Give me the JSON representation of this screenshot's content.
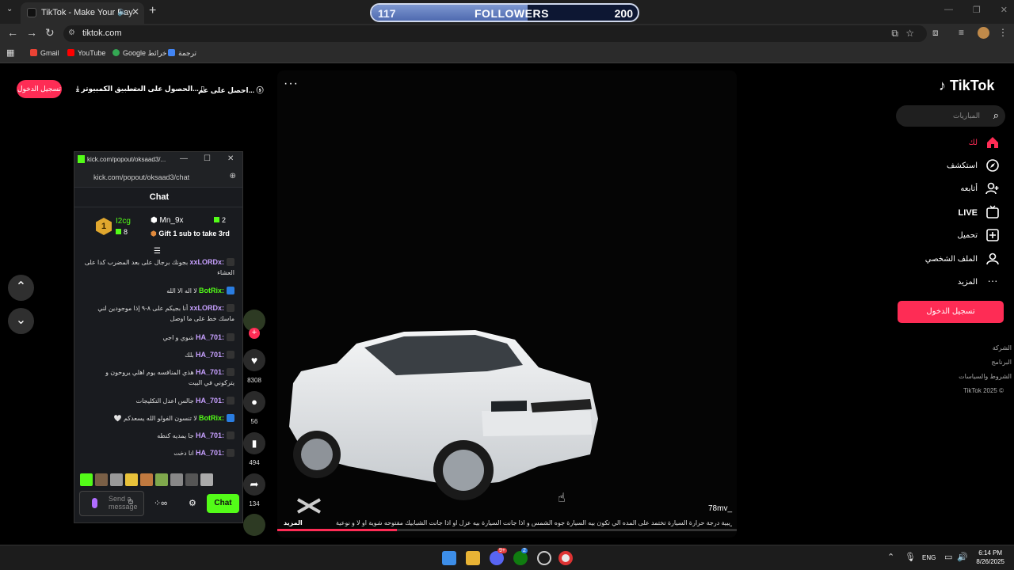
{
  "browser": {
    "tab_title": "TikTok - Make Your Day",
    "url": "tiktok.com",
    "bookmarks": [
      "Gmail",
      "YouTube",
      "Google خرائط",
      "ترجمة"
    ]
  },
  "followers_goal": {
    "current": "117",
    "label": "FOLLOWERS",
    "goal": "200",
    "progress_fraction": 0.585
  },
  "tiktok": {
    "brand": "TikTok",
    "top_login": "تسجيل الدخول",
    "top_links": [
      "تطبيق الكمبيوتر",
      "الحصول على الت...",
      "احصل على عم..."
    ],
    "search_placeholder": "المباريات",
    "sidebar": [
      {
        "label": "لك",
        "icon": "home-icon",
        "active": true
      },
      {
        "label": "استكشف",
        "icon": "compass-icon",
        "active": false
      },
      {
        "label": "أتابعه",
        "icon": "following-icon",
        "active": false
      },
      {
        "label": "LIVE",
        "icon": "live-icon",
        "active": false
      },
      {
        "label": "تحميل",
        "icon": "upload-icon",
        "active": false
      },
      {
        "label": "الملف الشخصي",
        "icon": "profile-icon",
        "active": false
      },
      {
        "label": "المزيد",
        "icon": "more-icon",
        "active": false
      }
    ],
    "side_login": "تسجيل الدخول",
    "footer": [
      "الشركة",
      "البرنامج",
      "الشروط والسياسات",
      "TikTok 2025 ©"
    ],
    "video": {
      "username": "78mv_",
      "caption": "ملاحضة : هاي ارقام تقريبية درجة حرارة السيارة تختمد على المده الي تكون بيه السيارة جوه الشمس و اذا جانت السيارة بيه عزل او اذا جانت الشبابيك مفتوحه شوية او لا و نوعية ...",
      "more_label": "المزيد",
      "progress_fraction": 0.26
    },
    "actions": {
      "likes": "8308",
      "comments": "56",
      "saves": "494",
      "shares": "134"
    }
  },
  "kick": {
    "window_title": "kick.com/popout/oksaad3/...",
    "url": "kick.com/popout/oksaad3/chat",
    "chat_title": "Chat",
    "leaderboard": {
      "first_name": "I2cg",
      "first_count": "8",
      "first_rank": "1",
      "second_name": "Mn_9x",
      "second_count": "2",
      "gift_text": "Gift 1 sub to take 3rd"
    },
    "messages": [
      {
        "user": "xxLORDx:",
        "text": "بجونك برجال على بعد المضرب كدا على العشاء",
        "color": "#c7a0ff"
      },
      {
        "user": "BotRix:",
        "text": "لا اله الا الله",
        "color": "#53fc18"
      },
      {
        "user": "xxLORDx:",
        "text": "أنا بجيكم على ٨-٩ إذا موجودين لني ماسك خط على ما اوصل",
        "color": "#c7a0ff"
      },
      {
        "user": "HA_701:",
        "text": "شوي و اجي",
        "color": "#c7a0ff"
      },
      {
        "user": "HA_701:",
        "text": "بلك",
        "color": "#c7a0ff"
      },
      {
        "user": "HA_701:",
        "text": "هذي المنافسه يوم اهلي يروحون و يتركوني في البيت",
        "color": "#c7a0ff"
      },
      {
        "user": "HA_701:",
        "text": "جالس اعدل التكليجات",
        "color": "#c7a0ff"
      },
      {
        "user": "BotRix:",
        "text": "لا تنسون الفولو الله يسعدكم 🤍",
        "color": "#53fc18"
      },
      {
        "user": "HA_701:",
        "text": "جا يمديه كنطه",
        "color": "#c7a0ff"
      },
      {
        "user": "HA_701:",
        "text": "انا دخت",
        "color": "#c7a0ff"
      }
    ],
    "send_placeholder": "Send a message",
    "send_button": "Chat"
  },
  "taskbar": {
    "lang": "ENG",
    "time": "6:14 PM",
    "date": "8/26/2025",
    "discord_badge": "9+",
    "xbox_badge": "2"
  },
  "colors": {
    "tiktok_red": "#fe2c55",
    "kick_green": "#53fc18"
  }
}
